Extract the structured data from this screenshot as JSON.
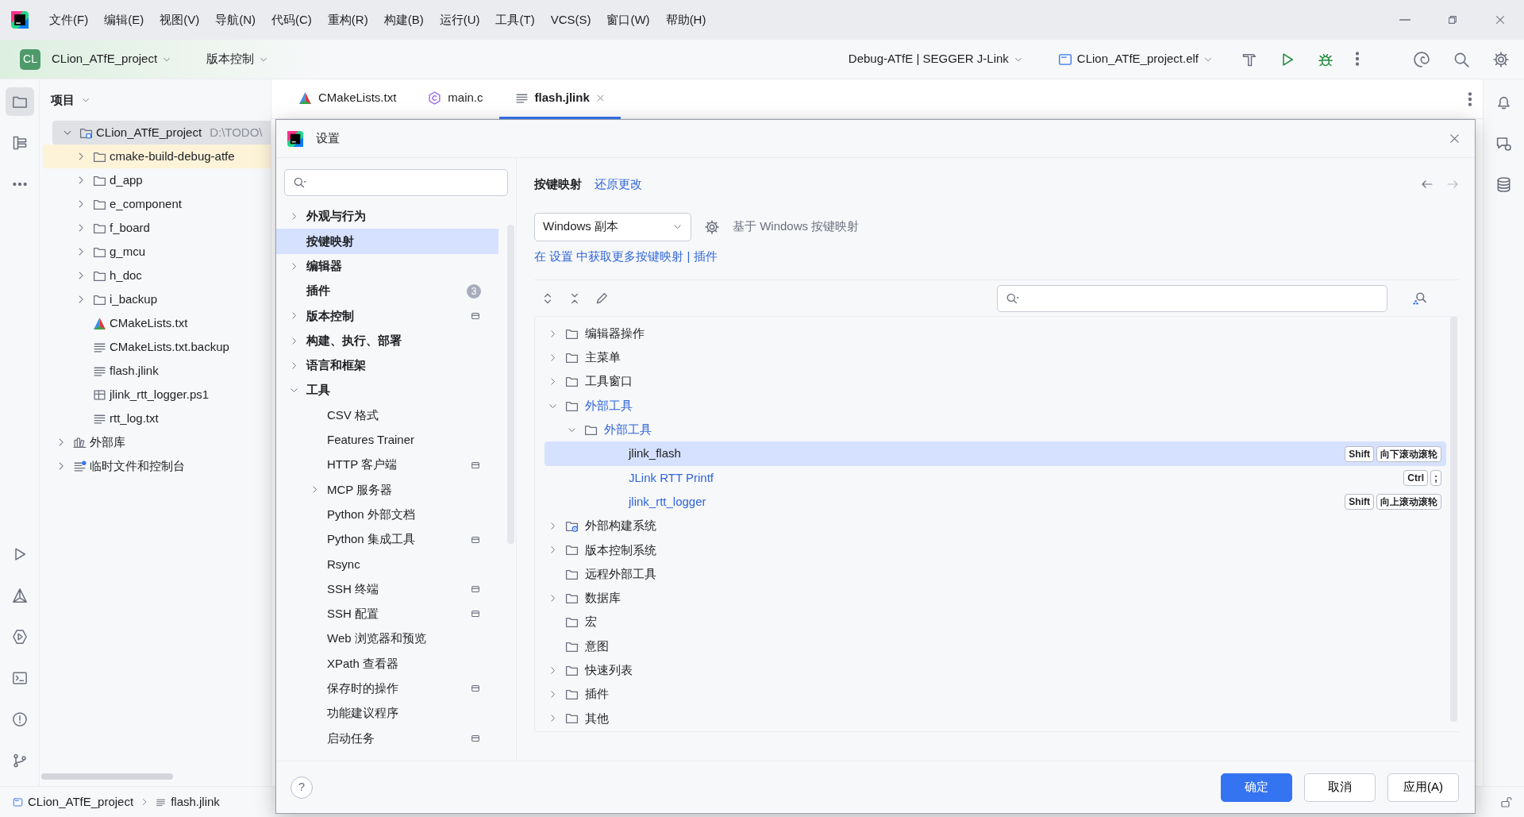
{
  "title_bar": {
    "menu": [
      "文件(F)",
      "编辑(E)",
      "视图(V)",
      "导航(N)",
      "代码(C)",
      "重构(R)",
      "构建(B)",
      "运行(U)",
      "工具(T)",
      "VCS(S)",
      "窗口(W)",
      "帮助(H)"
    ]
  },
  "toolbar": {
    "project_badge": "CL",
    "project": "CLion_ATfE_project",
    "vcs": "版本控制",
    "run_config": "Debug-ATfE | SEGGER J-Link",
    "target": "CLion_ATfE_project.elf"
  },
  "project_panel": {
    "title": "项目",
    "tree": [
      {
        "label": "CLion_ATfE_project",
        "path": "D:\\TODO\\",
        "kind": "module",
        "expanded": true,
        "selected": true,
        "excluded": false,
        "children": [
          {
            "label": "cmake-build-debug-atfe",
            "kind": "folder",
            "expanded": false,
            "selected": false,
            "excluded": true
          },
          {
            "label": "d_app",
            "kind": "folder",
            "expanded": false,
            "selected": false,
            "excluded": false
          },
          {
            "label": "e_component",
            "kind": "folder",
            "expanded": false,
            "selected": false,
            "excluded": false
          },
          {
            "label": "f_board",
            "kind": "folder",
            "expanded": false,
            "selected": false,
            "excluded": false
          },
          {
            "label": "g_mcu",
            "kind": "folder",
            "expanded": false,
            "selected": false,
            "excluded": false
          },
          {
            "label": "h_doc",
            "kind": "folder",
            "expanded": false,
            "selected": false,
            "excluded": false
          },
          {
            "label": "i_backup",
            "kind": "folder",
            "expanded": false,
            "selected": false,
            "excluded": false
          },
          {
            "label": "CMakeLists.txt",
            "kind": "cmake",
            "selected": false,
            "excluded": false
          },
          {
            "label": "CMakeLists.txt.backup",
            "kind": "text",
            "selected": false,
            "excluded": false
          },
          {
            "label": "flash.jlink",
            "kind": "text",
            "selected": false,
            "excluded": false
          },
          {
            "label": "jlink_rtt_logger.ps1",
            "kind": "script",
            "selected": false,
            "excluded": false
          },
          {
            "label": "rtt_log.txt",
            "kind": "text",
            "selected": false,
            "excluded": false
          }
        ]
      },
      {
        "label": "外部库",
        "kind": "library",
        "expanded": false,
        "selected": false,
        "excluded": false
      },
      {
        "label": "临时文件和控制台",
        "kind": "scratch",
        "expanded": false,
        "selected": false,
        "excluded": false
      }
    ]
  },
  "editor_tabs": [
    {
      "label": "CMakeLists.txt",
      "kind": "cmake",
      "selected": false
    },
    {
      "label": "main.c",
      "kind": "c",
      "selected": false
    },
    {
      "label": "flash.jlink",
      "kind": "text",
      "selected": true
    }
  ],
  "status_bar": {
    "breadcrumb": [
      "CLion_ATfE_project",
      "flash.jlink"
    ]
  },
  "dialog": {
    "title": "设置",
    "sidebar": [
      {
        "label": "外观与行为",
        "expanded": false,
        "selected": false,
        "project_scope": false
      },
      {
        "label": "按键映射",
        "selected": true,
        "project_scope": false
      },
      {
        "label": "编辑器",
        "expanded": false,
        "selected": false,
        "project_scope": false
      },
      {
        "label": "插件",
        "badge": "3",
        "selected": false,
        "project_scope": false
      },
      {
        "label": "版本控制",
        "expanded": false,
        "selected": false,
        "project_scope": true
      },
      {
        "label": "构建、执行、部署",
        "expanded": false,
        "selected": false,
        "project_scope": false
      },
      {
        "label": "语言和框架",
        "expanded": false,
        "selected": false,
        "project_scope": false
      },
      {
        "label": "工具",
        "expanded": true,
        "selected": false,
        "project_scope": false,
        "children": [
          {
            "label": "CSV 格式",
            "selected": false,
            "project_scope": false
          },
          {
            "label": "Features Trainer",
            "selected": false,
            "project_scope": false
          },
          {
            "label": "HTTP 客户端",
            "selected": false,
            "project_scope": true
          },
          {
            "label": "MCP 服务器",
            "expanded": false,
            "selected": false,
            "project_scope": false
          },
          {
            "label": "Python 外部文档",
            "selected": false,
            "project_scope": false
          },
          {
            "label": "Python 集成工具",
            "selected": false,
            "project_scope": true
          },
          {
            "label": "Rsync",
            "selected": false,
            "project_scope": false
          },
          {
            "label": "SSH 终端",
            "selected": false,
            "project_scope": true
          },
          {
            "label": "SSH 配置",
            "selected": false,
            "project_scope": true
          },
          {
            "label": "Web 浏览器和预览",
            "selected": false,
            "project_scope": false
          },
          {
            "label": "XPath 查看器",
            "selected": false,
            "project_scope": false
          },
          {
            "label": "保存时的操作",
            "selected": false,
            "project_scope": true
          },
          {
            "label": "功能建议程序",
            "selected": false,
            "project_scope": false
          },
          {
            "label": "启动任务",
            "selected": false,
            "project_scope": true
          }
        ]
      }
    ],
    "page": {
      "breadcrumb": "按键映射",
      "reset_link": "还原更改",
      "keymap": "Windows 副本",
      "based_on": "基于 Windows 按键映射",
      "more_link": "在 设置 中获取更多按键映射 | 插件",
      "tree": [
        {
          "label": "编辑器操作",
          "kind": "folder",
          "expanded": false,
          "selected": false,
          "modified": false
        },
        {
          "label": "主菜单",
          "kind": "folder",
          "expanded": false,
          "selected": false,
          "modified": false
        },
        {
          "label": "工具窗口",
          "kind": "folder",
          "expanded": false,
          "selected": false,
          "modified": false
        },
        {
          "label": "外部工具",
          "kind": "folder",
          "expanded": true,
          "selected": false,
          "modified": true,
          "children": [
            {
              "label": "外部工具",
              "kind": "folder",
              "expanded": true,
              "selected": false,
              "modified": true,
              "children": [
                {
                  "label": "jlink_flash",
                  "kind": "action",
                  "selected": true,
                  "modified": false,
                  "keys": [
                    "Shift",
                    "向下滚动滚轮"
                  ]
                },
                {
                  "label": "JLink RTT Printf",
                  "kind": "action",
                  "selected": false,
                  "modified": true,
                  "keys": [
                    "Ctrl",
                    ";"
                  ]
                },
                {
                  "label": "jlink_rtt_logger",
                  "kind": "action",
                  "selected": false,
                  "modified": true,
                  "keys": [
                    "Shift",
                    "向上滚动滚轮"
                  ]
                }
              ]
            }
          ]
        },
        {
          "label": "外部构建系统",
          "kind": "build",
          "expanded": false,
          "selected": false,
          "modified": false
        },
        {
          "label": "版本控制系统",
          "kind": "folder",
          "expanded": false,
          "selected": false,
          "modified": false
        },
        {
          "label": "远程外部工具",
          "kind": "folder",
          "selected": false,
          "modified": false
        },
        {
          "label": "数据库",
          "kind": "folder",
          "expanded": false,
          "selected": false,
          "modified": false
        },
        {
          "label": "宏",
          "kind": "folder",
          "selected": false,
          "modified": false
        },
        {
          "label": "意图",
          "kind": "folder",
          "selected": false,
          "modified": false
        },
        {
          "label": "快速列表",
          "kind": "folder",
          "expanded": false,
          "selected": false,
          "modified": false
        },
        {
          "label": "插件",
          "kind": "folder",
          "expanded": false,
          "selected": false,
          "modified": false
        },
        {
          "label": "其他",
          "kind": "folder",
          "expanded": false,
          "selected": false,
          "modified": false
        }
      ]
    },
    "help": "?",
    "buttons": [
      {
        "label": "确定",
        "primary": true
      },
      {
        "label": "取消",
        "primary": false
      },
      {
        "label": "应用(A)",
        "primary": false
      }
    ]
  }
}
